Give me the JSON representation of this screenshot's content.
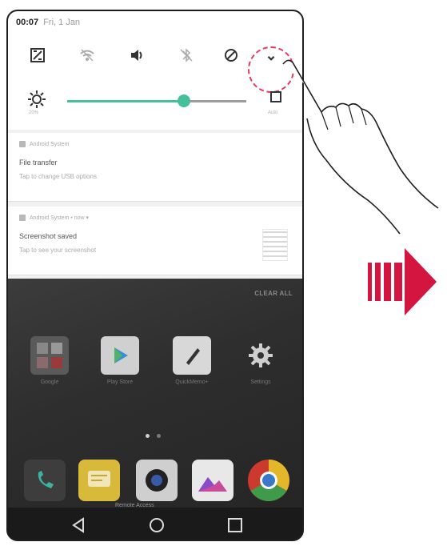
{
  "status": {
    "time": "00:07",
    "date": "Fri, 1 Jan"
  },
  "quick_settings": {
    "icons": [
      "screen-rotation-icon",
      "wifi-off-icon",
      "sound-icon",
      "bluetooth-off-icon",
      "do-not-disturb-icon",
      "expand-chevron-icon"
    ],
    "expand_glyph": "⌄"
  },
  "brightness": {
    "level_percent": 65,
    "sun_caption": "20%",
    "auto_caption": "Auto"
  },
  "notifications": [
    {
      "app": "Android System",
      "title": "File transfer",
      "body": "Tap to change USB options"
    },
    {
      "app": "Android System • now ▾",
      "title": "Screenshot saved",
      "body": "Tap to see your screenshot"
    }
  ],
  "home": {
    "clear_all": "CLEAR ALL",
    "apps": [
      {
        "label": "Google",
        "icon": "google-folder-icon"
      },
      {
        "label": "Play Store",
        "icon": "play-store-icon"
      },
      {
        "label": "QuickMemo+",
        "icon": "pen-icon"
      },
      {
        "label": "Settings",
        "icon": "gear-icon"
      }
    ],
    "dock_caption": "Remote Access",
    "dock": [
      "phone-icon",
      "messages-icon",
      "camera-icon",
      "gallery-icon",
      "chrome-icon"
    ]
  },
  "nav": [
    "back-icon",
    "home-icon",
    "recents-icon"
  ],
  "colors": {
    "accent": "#45c09a",
    "highlight": "#e23b5e",
    "arrow": "#d4153f"
  }
}
